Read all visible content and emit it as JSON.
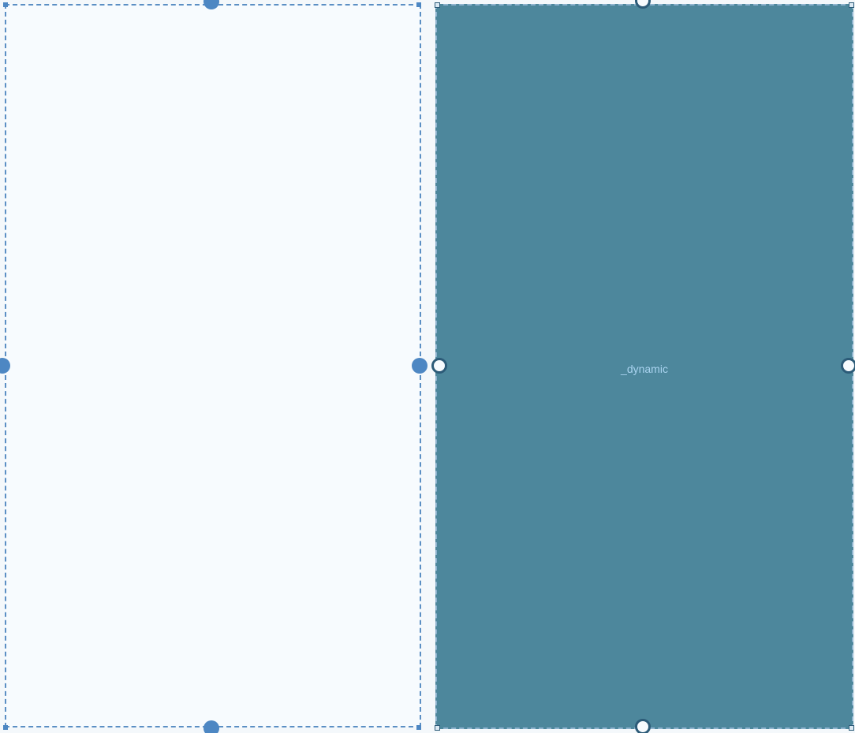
{
  "canvas": {
    "panes": [
      {
        "label": "",
        "selected": true,
        "fill_color": "#f7fbfe",
        "border_color": "#5b8fc4",
        "handle_style": "solid"
      },
      {
        "label": "_dynamic",
        "selected": false,
        "fill_color": "#4d879c",
        "border_color": "#8fb4cf",
        "handle_style": "hollow"
      }
    ]
  }
}
